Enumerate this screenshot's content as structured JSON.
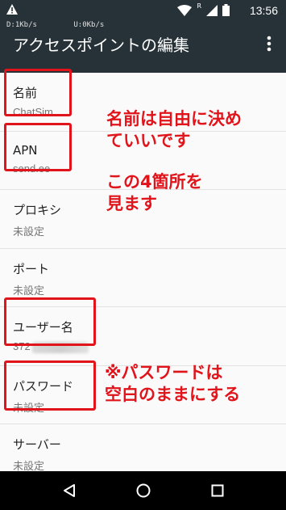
{
  "status_bar": {
    "time": "13:56",
    "download": "D:1Kb/s",
    "upload": "U:0Kb/s",
    "roaming": "R",
    "icons": [
      "warning-icon",
      "wifi-icon",
      "signal-icon",
      "battery-icon"
    ]
  },
  "app_bar": {
    "title": "アクセスポイントの編集",
    "menu_icon": "more-vert-icon"
  },
  "settings": [
    {
      "label": "名前",
      "value": "ChatSim"
    },
    {
      "label": "APN",
      "value": "send.ee"
    },
    {
      "label": "プロキシ",
      "value": "未設定"
    },
    {
      "label": "ポート",
      "value": "未設定"
    },
    {
      "label": "ユーザー名",
      "value": "372"
    },
    {
      "label": "パスワード",
      "value": "未設定"
    },
    {
      "label": "サーバー",
      "value": "未設定"
    }
  ],
  "annotations": {
    "note1": [
      "名前は自由に決め",
      "ていいです"
    ],
    "note2": [
      "この4箇所を",
      "見ます"
    ],
    "note3": [
      "※パスワードは",
      "空白のままにする"
    ],
    "color": "#e0141a"
  },
  "nav_bar": {
    "icons": [
      "back-icon",
      "home-icon",
      "recents-icon"
    ]
  }
}
